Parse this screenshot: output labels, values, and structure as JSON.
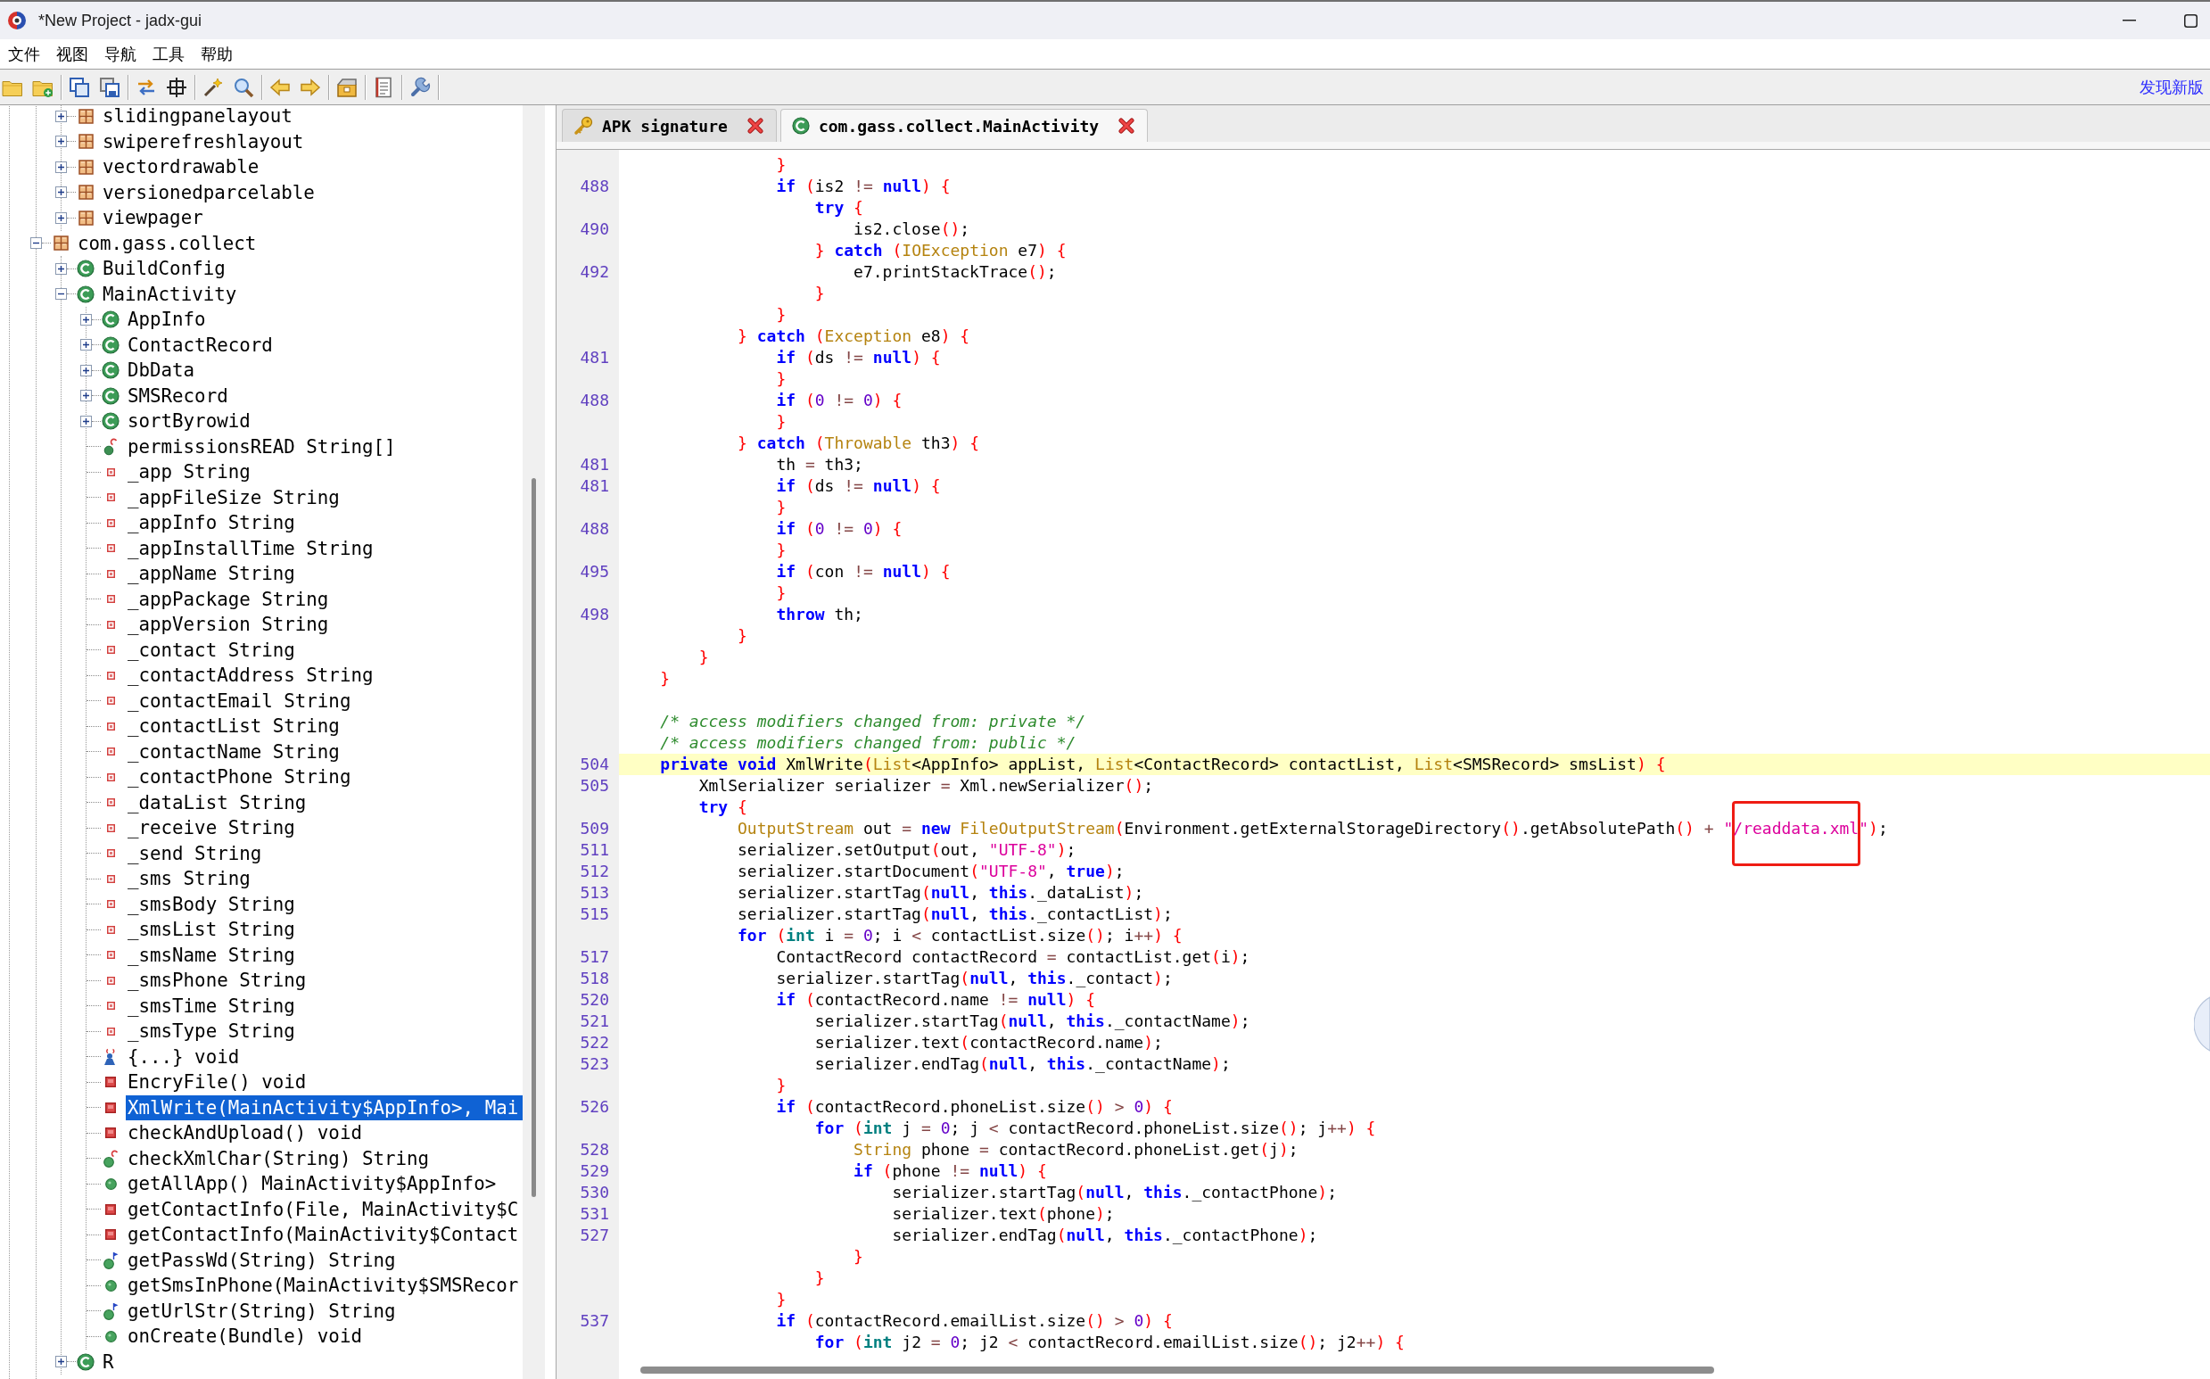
{
  "window": {
    "title": "*New Project - jadx-gui"
  },
  "menu": [
    "文件",
    "视图",
    "导航",
    "工具",
    "帮助"
  ],
  "toolbar": {
    "notice": "发现新版"
  },
  "tree": {
    "items": [
      {
        "children": [
          {
            "label": "slidingpanelayout",
            "kind": "package",
            "expanded": false,
            "selected": false
          },
          {
            "label": "swiperefreshlayout",
            "kind": "package",
            "expanded": false,
            "selected": false
          },
          {
            "label": "vectordrawable",
            "kind": "package",
            "expanded": false,
            "selected": false
          },
          {
            "label": "versionedparcelable",
            "kind": "package",
            "expanded": false,
            "selected": false
          },
          {
            "label": "viewpager",
            "kind": "package",
            "expanded": false,
            "selected": false
          }
        ]
      },
      {
        "label": "com.gass.collect",
        "kind": "package",
        "expanded": true,
        "selected": false,
        "children": [
          {
            "label": "BuildConfig",
            "kind": "class",
            "expanded": false,
            "selected": false
          },
          {
            "label": "MainActivity",
            "kind": "class",
            "expanded": true,
            "selected": false,
            "children": [
              {
                "label": "AppInfo",
                "kind": "class",
                "expanded": false,
                "selected": false
              },
              {
                "label": "ContactRecord",
                "kind": "class",
                "expanded": false,
                "selected": false
              },
              {
                "label": "DbData",
                "kind": "class",
                "expanded": false,
                "selected": false
              },
              {
                "label": "SMSRecord",
                "kind": "class",
                "expanded": false,
                "selected": false
              },
              {
                "label": "sortByrowid",
                "kind": "class",
                "expanded": false,
                "selected": false
              },
              {
                "label": "permissionsREAD String[]",
                "kind": "staticfield",
                "selected": false
              },
              {
                "label": "_app String",
                "kind": "field",
                "selected": false
              },
              {
                "label": "_appFileSize String",
                "kind": "field",
                "selected": false
              },
              {
                "label": "_appInfo String",
                "kind": "field",
                "selected": false
              },
              {
                "label": "_appInstallTime String",
                "kind": "field",
                "selected": false
              },
              {
                "label": "_appName String",
                "kind": "field",
                "selected": false
              },
              {
                "label": "_appPackage String",
                "kind": "field",
                "selected": false
              },
              {
                "label": "_appVersion String",
                "kind": "field",
                "selected": false
              },
              {
                "label": "_contact String",
                "kind": "field",
                "selected": false
              },
              {
                "label": "_contactAddress String",
                "kind": "field",
                "selected": false
              },
              {
                "label": "_contactEmail String",
                "kind": "field",
                "selected": false
              },
              {
                "label": "_contactList String",
                "kind": "field",
                "selected": false
              },
              {
                "label": "_contactName String",
                "kind": "field",
                "selected": false
              },
              {
                "label": "_contactPhone String",
                "kind": "field",
                "selected": false
              },
              {
                "label": "_dataList String",
                "kind": "field",
                "selected": false
              },
              {
                "label": "_receive String",
                "kind": "field",
                "selected": false
              },
              {
                "label": "_send String",
                "kind": "field",
                "selected": false
              },
              {
                "label": "_sms String",
                "kind": "field",
                "selected": false
              },
              {
                "label": "_smsBody String",
                "kind": "field",
                "selected": false
              },
              {
                "label": "_smsList String",
                "kind": "field",
                "selected": false
              },
              {
                "label": "_smsName String",
                "kind": "field",
                "selected": false
              },
              {
                "label": "_smsPhone String",
                "kind": "field",
                "selected": false
              },
              {
                "label": "_smsTime String",
                "kind": "field",
                "selected": false
              },
              {
                "label": "_smsType String",
                "kind": "field",
                "selected": false
              },
              {
                "label": "{...} void",
                "kind": "initializer",
                "selected": false
              },
              {
                "label": "EncryFile() void",
                "kind": "privatemethod",
                "selected": false
              },
              {
                "label": "XmlWrite(MainActivity$AppInfo>, Mai",
                "kind": "privatemethod",
                "selected": true
              },
              {
                "label": "checkAndUpload() void",
                "kind": "privatemethod",
                "selected": false
              },
              {
                "label": "checkXmlChar(String) String",
                "kind": "staticmethod",
                "selected": false
              },
              {
                "label": "getAllApp() MainActivity$AppInfo>",
                "kind": "method",
                "selected": false
              },
              {
                "label": "getContactInfo(File, MainActivity$C",
                "kind": "privatemethod",
                "selected": false
              },
              {
                "label": "getContactInfo(MainActivity$Contact",
                "kind": "privatemethod",
                "selected": false
              },
              {
                "label": "getPassWd(String) String",
                "kind": "nativemethod",
                "selected": false
              },
              {
                "label": "getSmsInPhone(MainActivity$SMSRecor",
                "kind": "method",
                "selected": false
              },
              {
                "label": "getUrlStr(String) String",
                "kind": "nativemethod",
                "selected": false
              },
              {
                "label": "onCreate(Bundle) void",
                "kind": "method",
                "selected": false
              }
            ]
          },
          {
            "label": "R",
            "kind": "class",
            "expanded": false,
            "selected": false
          }
        ]
      }
    ]
  },
  "editor": {
    "tabs": [
      {
        "label": "APK signature",
        "kind": "signature",
        "selected": false
      },
      {
        "label": "com.gass.collect.MainActivity",
        "kind": "class",
        "selected": true
      }
    ],
    "lines": [
      {
        "current": false,
        "code": [
          {
            "kind": "bracket",
            "text": "                }"
          }
        ]
      },
      {
        "number": "488",
        "current": false,
        "code": [
          {
            "kind": "keyword",
            "text": "                if"
          },
          {
            "kind": "bracket",
            "text": " ("
          },
          {
            "kind": "plain",
            "text": "is2 "
          },
          {
            "kind": "operator",
            "text": "!= "
          },
          {
            "kind": "keyword",
            "text": "null"
          },
          {
            "kind": "bracket",
            "text": ") {"
          }
        ]
      },
      {
        "current": false,
        "code": [
          {
            "kind": "keyword",
            "text": "                    try"
          },
          {
            "kind": "bracket",
            "text": " {"
          }
        ]
      },
      {
        "number": "490",
        "current": false,
        "code": [
          {
            "kind": "plain",
            "text": "                        is2.close"
          },
          {
            "kind": "bracket",
            "text": "()"
          },
          {
            "kind": "plain",
            "text": ";"
          }
        ]
      },
      {
        "current": false,
        "code": [
          {
            "kind": "bracket",
            "text": "                    }"
          },
          {
            "kind": "keyword",
            "text": " catch"
          },
          {
            "kind": "bracket",
            "text": " ("
          },
          {
            "kind": "type",
            "text": "IOException"
          },
          {
            "kind": "plain",
            "text": " e7"
          },
          {
            "kind": "bracket",
            "text": ") {"
          }
        ]
      },
      {
        "number": "492",
        "current": false,
        "code": [
          {
            "kind": "plain",
            "text": "                        e7.printStackTrace"
          },
          {
            "kind": "bracket",
            "text": "()"
          },
          {
            "kind": "plain",
            "text": ";"
          }
        ]
      },
      {
        "current": false,
        "code": [
          {
            "kind": "bracket",
            "text": "                    }"
          }
        ]
      },
      {
        "current": false,
        "code": [
          {
            "kind": "bracket",
            "text": "                }"
          }
        ]
      },
      {
        "current": false,
        "code": [
          {
            "kind": "bracket",
            "text": "            }"
          },
          {
            "kind": "keyword",
            "text": " catch"
          },
          {
            "kind": "bracket",
            "text": " ("
          },
          {
            "kind": "type",
            "text": "Exception"
          },
          {
            "kind": "plain",
            "text": " e8"
          },
          {
            "kind": "bracket",
            "text": ") {"
          }
        ]
      },
      {
        "number": "481",
        "current": false,
        "code": [
          {
            "kind": "keyword",
            "text": "                if"
          },
          {
            "kind": "bracket",
            "text": " ("
          },
          {
            "kind": "plain",
            "text": "ds "
          },
          {
            "kind": "operator",
            "text": "!= "
          },
          {
            "kind": "keyword",
            "text": "null"
          },
          {
            "kind": "bracket",
            "text": ") {"
          }
        ]
      },
      {
        "current": false,
        "code": [
          {
            "kind": "bracket",
            "text": "                }"
          }
        ]
      },
      {
        "number": "488",
        "current": false,
        "code": [
          {
            "kind": "keyword",
            "text": "                if"
          },
          {
            "kind": "bracket",
            "text": " ("
          },
          {
            "kind": "number",
            "text": "0"
          },
          {
            "kind": "operator",
            "text": " != "
          },
          {
            "kind": "number",
            "text": "0"
          },
          {
            "kind": "bracket",
            "text": ") {"
          }
        ]
      },
      {
        "current": false,
        "code": [
          {
            "kind": "bracket",
            "text": "                }"
          }
        ]
      },
      {
        "current": false,
        "code": [
          {
            "kind": "bracket",
            "text": "            }"
          },
          {
            "kind": "keyword",
            "text": " catch"
          },
          {
            "kind": "bracket",
            "text": " ("
          },
          {
            "kind": "type",
            "text": "Throwable"
          },
          {
            "kind": "plain",
            "text": " th3"
          },
          {
            "kind": "bracket",
            "text": ") {"
          }
        ]
      },
      {
        "number": "481",
        "current": false,
        "code": [
          {
            "kind": "plain",
            "text": "                th "
          },
          {
            "kind": "operator",
            "text": "= "
          },
          {
            "kind": "plain",
            "text": "th3;"
          }
        ]
      },
      {
        "number": "481",
        "current": false,
        "code": [
          {
            "kind": "keyword",
            "text": "                if"
          },
          {
            "kind": "bracket",
            "text": " ("
          },
          {
            "kind": "plain",
            "text": "ds "
          },
          {
            "kind": "operator",
            "text": "!= "
          },
          {
            "kind": "keyword",
            "text": "null"
          },
          {
            "kind": "bracket",
            "text": ") {"
          }
        ]
      },
      {
        "current": false,
        "code": [
          {
            "kind": "bracket",
            "text": "                }"
          }
        ]
      },
      {
        "number": "488",
        "current": false,
        "code": [
          {
            "kind": "keyword",
            "text": "                if"
          },
          {
            "kind": "bracket",
            "text": " ("
          },
          {
            "kind": "number",
            "text": "0"
          },
          {
            "kind": "operator",
            "text": " != "
          },
          {
            "kind": "number",
            "text": "0"
          },
          {
            "kind": "bracket",
            "text": ") {"
          }
        ]
      },
      {
        "current": false,
        "code": [
          {
            "kind": "bracket",
            "text": "                }"
          }
        ]
      },
      {
        "number": "495",
        "current": false,
        "code": [
          {
            "kind": "keyword",
            "text": "                if"
          },
          {
            "kind": "bracket",
            "text": " ("
          },
          {
            "kind": "plain",
            "text": "con "
          },
          {
            "kind": "operator",
            "text": "!= "
          },
          {
            "kind": "keyword",
            "text": "null"
          },
          {
            "kind": "bracket",
            "text": ") {"
          }
        ]
      },
      {
        "current": false,
        "code": [
          {
            "kind": "bracket",
            "text": "                }"
          }
        ]
      },
      {
        "number": "498",
        "current": false,
        "code": [
          {
            "kind": "keyword",
            "text": "                throw"
          },
          {
            "kind": "plain",
            "text": " th;"
          }
        ]
      },
      {
        "current": false,
        "code": [
          {
            "kind": "bracket",
            "text": "            }"
          }
        ]
      },
      {
        "current": false,
        "code": [
          {
            "kind": "bracket",
            "text": "        }"
          }
        ]
      },
      {
        "current": false,
        "code": [
          {
            "kind": "bracket",
            "text": "    }"
          }
        ]
      },
      {
        "current": false
      },
      {
        "current": false,
        "code": [
          {
            "kind": "comment",
            "text": "    /* access modifiers changed from: private */"
          }
        ]
      },
      {
        "current": false,
        "code": [
          {
            "kind": "comment",
            "text": "    /* access modifiers changed from: public */"
          }
        ]
      },
      {
        "number": "504",
        "current": true,
        "code": [
          {
            "kind": "keyword",
            "text": "    private void"
          },
          {
            "kind": "plain",
            "text": " XmlWrite"
          },
          {
            "kind": "bracket",
            "text": "("
          },
          {
            "kind": "type",
            "text": "List"
          },
          {
            "kind": "plain",
            "text": "<AppInfo> appList, "
          },
          {
            "kind": "type",
            "text": "List"
          },
          {
            "kind": "plain",
            "text": "<ContactRecord> contactList, "
          },
          {
            "kind": "type",
            "text": "List"
          },
          {
            "kind": "plain",
            "text": "<SMSRecord> smsList"
          },
          {
            "kind": "bracket",
            "text": ") {"
          }
        ]
      },
      {
        "number": "505",
        "current": false,
        "code": [
          {
            "kind": "plain",
            "text": "        XmlSerializer serializer "
          },
          {
            "kind": "operator",
            "text": "= "
          },
          {
            "kind": "plain",
            "text": "Xml.newSerializer"
          },
          {
            "kind": "bracket",
            "text": "()"
          },
          {
            "kind": "plain",
            "text": ";"
          }
        ]
      },
      {
        "current": false,
        "code": [
          {
            "kind": "keyword",
            "text": "        try"
          },
          {
            "kind": "bracket",
            "text": " {"
          }
        ]
      },
      {
        "number": "509",
        "current": false,
        "code": [
          {
            "kind": "type",
            "text": "            OutputStream"
          },
          {
            "kind": "plain",
            "text": " out "
          },
          {
            "kind": "operator",
            "text": "= "
          },
          {
            "kind": "keyword",
            "text": "new"
          },
          {
            "kind": "type",
            "text": " FileOutputStream"
          },
          {
            "kind": "bracket",
            "text": "("
          },
          {
            "kind": "plain",
            "text": "Environment.getExternalStorageDirectory"
          },
          {
            "kind": "bracket",
            "text": "()"
          },
          {
            "kind": "plain",
            "text": ".getAbsolutePath"
          },
          {
            "kind": "bracket",
            "text": "()"
          },
          {
            "kind": "operator",
            "text": " + "
          },
          {
            "kind": "string",
            "text": "\"/readdata.xml\"",
            "boxed": true
          },
          {
            "kind": "bracket",
            "text": ")"
          },
          {
            "kind": "plain",
            "text": ";"
          }
        ]
      },
      {
        "number": "511",
        "current": false,
        "code": [
          {
            "kind": "plain",
            "text": "            serializer.setOutput"
          },
          {
            "kind": "bracket",
            "text": "("
          },
          {
            "kind": "plain",
            "text": "out, "
          },
          {
            "kind": "string",
            "text": "\"UTF-8\""
          },
          {
            "kind": "bracket",
            "text": ")"
          },
          {
            "kind": "plain",
            "text": ";"
          }
        ]
      },
      {
        "number": "512",
        "current": false,
        "code": [
          {
            "kind": "plain",
            "text": "            serializer.startDocument"
          },
          {
            "kind": "bracket",
            "text": "("
          },
          {
            "kind": "string",
            "text": "\"UTF-8\""
          },
          {
            "kind": "plain",
            "text": ", "
          },
          {
            "kind": "keyword",
            "text": "true"
          },
          {
            "kind": "bracket",
            "text": ")"
          },
          {
            "kind": "plain",
            "text": ";"
          }
        ]
      },
      {
        "number": "513",
        "current": false,
        "code": [
          {
            "kind": "plain",
            "text": "            serializer.startTag"
          },
          {
            "kind": "bracket",
            "text": "("
          },
          {
            "kind": "keyword",
            "text": "null"
          },
          {
            "kind": "plain",
            "text": ", "
          },
          {
            "kind": "keyword",
            "text": "this"
          },
          {
            "kind": "plain",
            "text": "._dataList"
          },
          {
            "kind": "bracket",
            "text": ")"
          },
          {
            "kind": "plain",
            "text": ";"
          }
        ]
      },
      {
        "number": "515",
        "current": false,
        "code": [
          {
            "kind": "plain",
            "text": "            serializer.startTag"
          },
          {
            "kind": "bracket",
            "text": "("
          },
          {
            "kind": "keyword",
            "text": "null"
          },
          {
            "kind": "plain",
            "text": ", "
          },
          {
            "kind": "keyword",
            "text": "this"
          },
          {
            "kind": "plain",
            "text": "._contactList"
          },
          {
            "kind": "bracket",
            "text": ")"
          },
          {
            "kind": "plain",
            "text": ";"
          }
        ]
      },
      {
        "current": false,
        "code": [
          {
            "kind": "keyword",
            "text": "            for"
          },
          {
            "kind": "bracket",
            "text": " ("
          },
          {
            "kind": "datatype",
            "text": "int"
          },
          {
            "kind": "plain",
            "text": " i "
          },
          {
            "kind": "operator",
            "text": "= "
          },
          {
            "kind": "number",
            "text": "0"
          },
          {
            "kind": "plain",
            "text": "; i "
          },
          {
            "kind": "operator",
            "text": "< "
          },
          {
            "kind": "plain",
            "text": "contactList.size"
          },
          {
            "kind": "bracket",
            "text": "()"
          },
          {
            "kind": "plain",
            "text": "; i"
          },
          {
            "kind": "operator",
            "text": "++"
          },
          {
            "kind": "bracket",
            "text": ") {"
          }
        ]
      },
      {
        "number": "517",
        "current": false,
        "code": [
          {
            "kind": "plain",
            "text": "                ContactRecord contactRecord "
          },
          {
            "kind": "operator",
            "text": "= "
          },
          {
            "kind": "plain",
            "text": "contactList.get"
          },
          {
            "kind": "bracket",
            "text": "("
          },
          {
            "kind": "plain",
            "text": "i"
          },
          {
            "kind": "bracket",
            "text": ")"
          },
          {
            "kind": "plain",
            "text": ";"
          }
        ]
      },
      {
        "number": "518",
        "current": false,
        "code": [
          {
            "kind": "plain",
            "text": "                serializer.startTag"
          },
          {
            "kind": "bracket",
            "text": "("
          },
          {
            "kind": "keyword",
            "text": "null"
          },
          {
            "kind": "plain",
            "text": ", "
          },
          {
            "kind": "keyword",
            "text": "this"
          },
          {
            "kind": "plain",
            "text": "._contact"
          },
          {
            "kind": "bracket",
            "text": ")"
          },
          {
            "kind": "plain",
            "text": ";"
          }
        ]
      },
      {
        "number": "520",
        "current": false,
        "code": [
          {
            "kind": "keyword",
            "text": "                if"
          },
          {
            "kind": "bracket",
            "text": " ("
          },
          {
            "kind": "plain",
            "text": "contactRecord.name "
          },
          {
            "kind": "operator",
            "text": "!= "
          },
          {
            "kind": "keyword",
            "text": "null"
          },
          {
            "kind": "bracket",
            "text": ") {"
          }
        ]
      },
      {
        "number": "521",
        "current": false,
        "code": [
          {
            "kind": "plain",
            "text": "                    serializer.startTag"
          },
          {
            "kind": "bracket",
            "text": "("
          },
          {
            "kind": "keyword",
            "text": "null"
          },
          {
            "kind": "plain",
            "text": ", "
          },
          {
            "kind": "keyword",
            "text": "this"
          },
          {
            "kind": "plain",
            "text": "._contactName"
          },
          {
            "kind": "bracket",
            "text": ")"
          },
          {
            "kind": "plain",
            "text": ";"
          }
        ]
      },
      {
        "number": "522",
        "current": false,
        "code": [
          {
            "kind": "plain",
            "text": "                    serializer.text"
          },
          {
            "kind": "bracket",
            "text": "("
          },
          {
            "kind": "plain",
            "text": "contactRecord.name"
          },
          {
            "kind": "bracket",
            "text": ")"
          },
          {
            "kind": "plain",
            "text": ";"
          }
        ]
      },
      {
        "number": "523",
        "current": false,
        "code": [
          {
            "kind": "plain",
            "text": "                    serializer.endTag"
          },
          {
            "kind": "bracket",
            "text": "("
          },
          {
            "kind": "keyword",
            "text": "null"
          },
          {
            "kind": "plain",
            "text": ", "
          },
          {
            "kind": "keyword",
            "text": "this"
          },
          {
            "kind": "plain",
            "text": "._contactName"
          },
          {
            "kind": "bracket",
            "text": ")"
          },
          {
            "kind": "plain",
            "text": ";"
          }
        ]
      },
      {
        "current": false,
        "code": [
          {
            "kind": "bracket",
            "text": "                }"
          }
        ]
      },
      {
        "number": "526",
        "current": false,
        "code": [
          {
            "kind": "keyword",
            "text": "                if"
          },
          {
            "kind": "bracket",
            "text": " ("
          },
          {
            "kind": "plain",
            "text": "contactRecord.phoneList.size"
          },
          {
            "kind": "bracket",
            "text": "()"
          },
          {
            "kind": "operator",
            "text": " > "
          },
          {
            "kind": "number",
            "text": "0"
          },
          {
            "kind": "bracket",
            "text": ") {"
          }
        ]
      },
      {
        "current": false,
        "code": [
          {
            "kind": "keyword",
            "text": "                    for"
          },
          {
            "kind": "bracket",
            "text": " ("
          },
          {
            "kind": "datatype",
            "text": "int"
          },
          {
            "kind": "plain",
            "text": " j "
          },
          {
            "kind": "operator",
            "text": "= "
          },
          {
            "kind": "number",
            "text": "0"
          },
          {
            "kind": "plain",
            "text": "; j "
          },
          {
            "kind": "operator",
            "text": "< "
          },
          {
            "kind": "plain",
            "text": "contactRecord.phoneList.size"
          },
          {
            "kind": "bracket",
            "text": "()"
          },
          {
            "kind": "plain",
            "text": "; j"
          },
          {
            "kind": "operator",
            "text": "++"
          },
          {
            "kind": "bracket",
            "text": ") {"
          }
        ]
      },
      {
        "number": "528",
        "current": false,
        "code": [
          {
            "kind": "type",
            "text": "                        String"
          },
          {
            "kind": "plain",
            "text": " phone "
          },
          {
            "kind": "operator",
            "text": "= "
          },
          {
            "kind": "plain",
            "text": "contactRecord.phoneList.get"
          },
          {
            "kind": "bracket",
            "text": "("
          },
          {
            "kind": "plain",
            "text": "j"
          },
          {
            "kind": "bracket",
            "text": ")"
          },
          {
            "kind": "plain",
            "text": ";"
          }
        ]
      },
      {
        "number": "529",
        "current": false,
        "code": [
          {
            "kind": "keyword",
            "text": "                        if"
          },
          {
            "kind": "bracket",
            "text": " ("
          },
          {
            "kind": "plain",
            "text": "phone "
          },
          {
            "kind": "operator",
            "text": "!= "
          },
          {
            "kind": "keyword",
            "text": "null"
          },
          {
            "kind": "bracket",
            "text": ") {"
          }
        ]
      },
      {
        "number": "530",
        "current": false,
        "code": [
          {
            "kind": "plain",
            "text": "                            serializer.startTag"
          },
          {
            "kind": "bracket",
            "text": "("
          },
          {
            "kind": "keyword",
            "text": "null"
          },
          {
            "kind": "plain",
            "text": ", "
          },
          {
            "kind": "keyword",
            "text": "this"
          },
          {
            "kind": "plain",
            "text": "._contactPhone"
          },
          {
            "kind": "bracket",
            "text": ")"
          },
          {
            "kind": "plain",
            "text": ";"
          }
        ]
      },
      {
        "number": "531",
        "current": false,
        "code": [
          {
            "kind": "plain",
            "text": "                            serializer.text"
          },
          {
            "kind": "bracket",
            "text": "("
          },
          {
            "kind": "plain",
            "text": "phone"
          },
          {
            "kind": "bracket",
            "text": ")"
          },
          {
            "kind": "plain",
            "text": ";"
          }
        ]
      },
      {
        "number": "527",
        "current": false,
        "code": [
          {
            "kind": "plain",
            "text": "                            serializer.endTag"
          },
          {
            "kind": "bracket",
            "text": "("
          },
          {
            "kind": "keyword",
            "text": "null"
          },
          {
            "kind": "plain",
            "text": ", "
          },
          {
            "kind": "keyword",
            "text": "this"
          },
          {
            "kind": "plain",
            "text": "._contactPhone"
          },
          {
            "kind": "bracket",
            "text": ")"
          },
          {
            "kind": "plain",
            "text": ";"
          }
        ]
      },
      {
        "current": false,
        "code": [
          {
            "kind": "bracket",
            "text": "                        }"
          }
        ]
      },
      {
        "current": false,
        "code": [
          {
            "kind": "bracket",
            "text": "                    }"
          }
        ]
      },
      {
        "current": false,
        "code": [
          {
            "kind": "bracket",
            "text": "                }"
          }
        ]
      },
      {
        "number": "537",
        "current": false,
        "code": [
          {
            "kind": "keyword",
            "text": "                if"
          },
          {
            "kind": "bracket",
            "text": " ("
          },
          {
            "kind": "plain",
            "text": "contactRecord.emailList.size"
          },
          {
            "kind": "bracket",
            "text": "()"
          },
          {
            "kind": "operator",
            "text": " > "
          },
          {
            "kind": "number",
            "text": "0"
          },
          {
            "kind": "bracket",
            "text": ") {"
          }
        ]
      },
      {
        "current": false,
        "code": [
          {
            "kind": "keyword",
            "text": "                    for"
          },
          {
            "kind": "bracket",
            "text": " ("
          },
          {
            "kind": "datatype",
            "text": "int"
          },
          {
            "kind": "plain",
            "text": " j2 "
          },
          {
            "kind": "operator",
            "text": "= "
          },
          {
            "kind": "number",
            "text": "0"
          },
          {
            "kind": "plain",
            "text": "; j2 "
          },
          {
            "kind": "operator",
            "text": "< "
          },
          {
            "kind": "plain",
            "text": "contactRecord.emailList.size"
          },
          {
            "kind": "bracket",
            "text": "()"
          },
          {
            "kind": "plain",
            "text": "; j2"
          },
          {
            "kind": "operator",
            "text": "++"
          },
          {
            "kind": "bracket",
            "text": ") {"
          }
        ]
      }
    ]
  }
}
